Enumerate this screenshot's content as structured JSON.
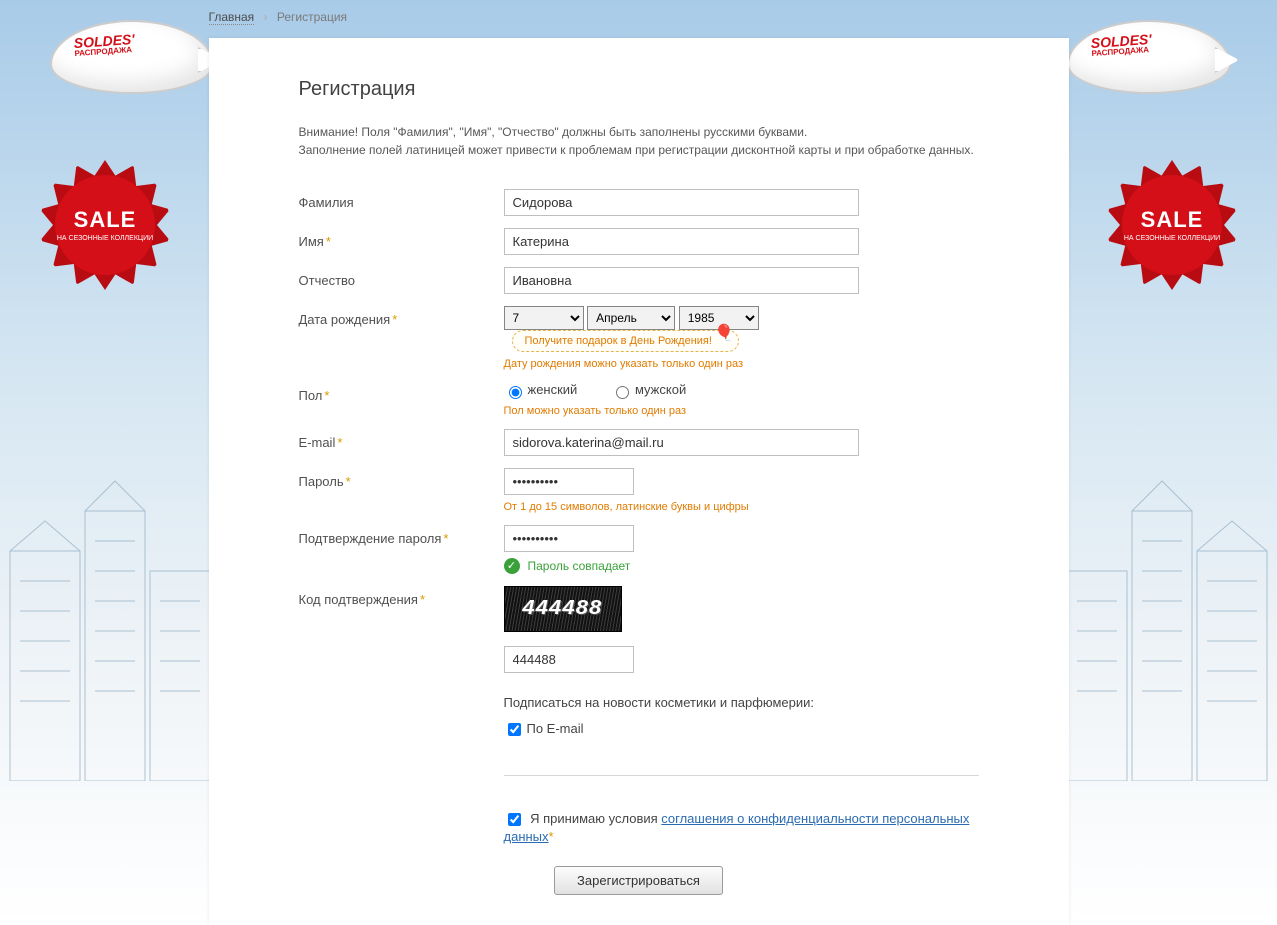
{
  "breadcrumb": {
    "home": "Главная",
    "current": "Регистрация"
  },
  "title": "Регистрация",
  "warning_l1": "Внимание! Поля \"Фамилия\", \"Имя\", \"Отчество\" должны быть заполнены русскими буквами.",
  "warning_l2": "Заполнение полей латиницей может привести к проблемам при регистрации дисконтной карты и при обработке данных.",
  "labels": {
    "lastname": "Фамилия",
    "firstname": "Имя",
    "patronymic": "Отчество",
    "birthdate": "Дата рождения",
    "gender": "Пол",
    "email": "E-mail",
    "password": "Пароль",
    "password_confirm": "Подтверждение пароля",
    "captcha": "Код подтверждения"
  },
  "values": {
    "lastname": "Сидорова",
    "firstname": "Катерина",
    "patronymic": "Ивановна",
    "day": "7",
    "month": "Апрель",
    "year": "1985",
    "email": "sidorova.katerina@mail.ru",
    "password": "••••••••••",
    "password_confirm": "••••••••••",
    "captcha_display": "444488",
    "captcha_input": "444488"
  },
  "hints": {
    "birthdate": "Дату рождения можно указать только один раз",
    "gender": "Пол можно указать только один раз",
    "password": "От 1 до 15 символов, латинские буквы и цифры",
    "match": "Пароль совпадает"
  },
  "gift": "Получите подарок в День Рождения!",
  "gender": {
    "female": "женский",
    "male": "мужской"
  },
  "newsletter": {
    "head": "Подписаться на новости косметики и парфюмерии:",
    "byemail": "По E-mail"
  },
  "agreement": {
    "pre": "Я принимаю условия ",
    "link": "соглашения о конфиденциальности персональных данных"
  },
  "button": "Зарегистрироваться",
  "decor": {
    "soldes": "SOLDES'",
    "rasp": "РАСПРОДАЖА",
    "sale": "SALE",
    "sale_sub": "НА СЕЗОННЫЕ КОЛЛЕКЦИИ"
  }
}
